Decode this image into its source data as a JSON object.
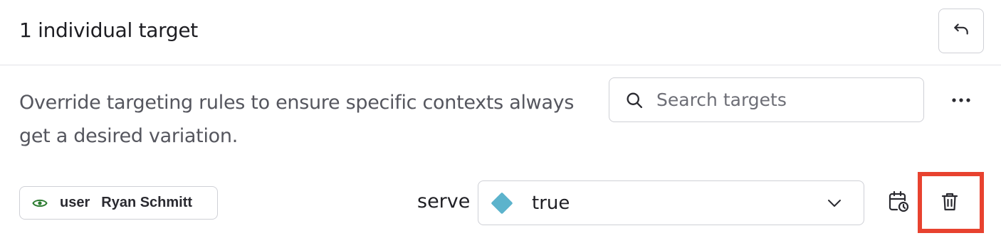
{
  "header": {
    "title": "1 individual target",
    "undo_icon": "undo-icon"
  },
  "description": "Override targeting rules to ensure specific contexts always get a desired variation.",
  "search": {
    "placeholder": "Search targets",
    "value": "",
    "icon": "search-icon"
  },
  "more_icon": "more-horizontal-icon",
  "target": {
    "kind": "user",
    "name": "Ryan Schmitt",
    "icon": "eye-icon",
    "icon_color": "#2e7d32"
  },
  "serve": {
    "label": "serve",
    "selected_value": "true",
    "color": "#5cb3cc",
    "icon": "chevron-down-icon"
  },
  "row_actions": {
    "schedule_icon": "calendar-clock-icon",
    "delete_icon": "trash-icon",
    "highlight_color": "#e8422f"
  }
}
